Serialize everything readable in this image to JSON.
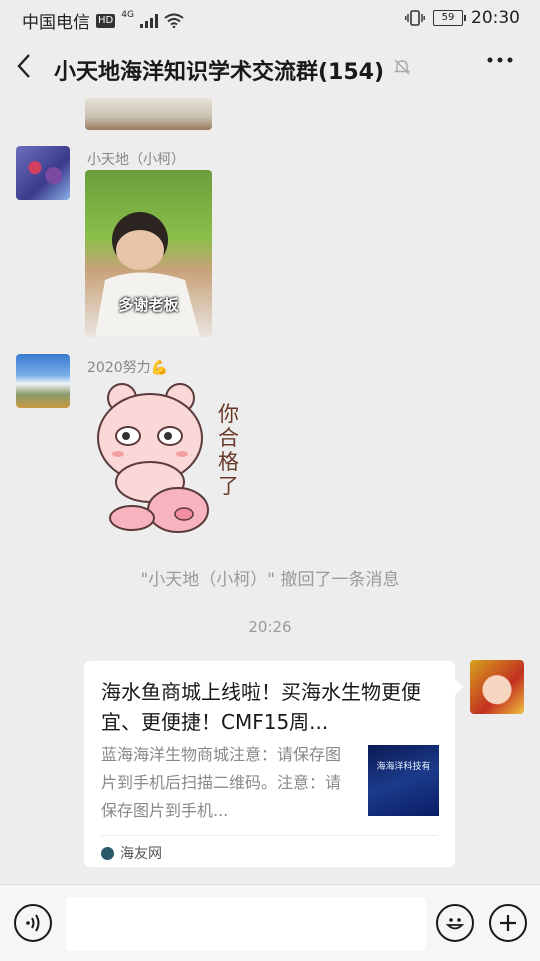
{
  "status": {
    "carrier": "中国电信",
    "hd": "HD",
    "network": "4G",
    "signal_icon": "signal-bars-icon",
    "wifi_icon": "wifi-icon",
    "vibrate_icon": "vibrate-icon",
    "battery": "59",
    "time": "20:30"
  },
  "header": {
    "back_icon": "back-chevron-icon",
    "title": "小天地海洋知识学术交流群(154)",
    "mute_icon": "bell-muted-icon",
    "more_icon": "more-dots-icon"
  },
  "messages": [
    {
      "type": "image",
      "caption": "多谢老板",
      "sender": "小天地（小柯）"
    },
    {
      "type": "sticker",
      "sender": "2020努力💪",
      "sticker_text": "你合格了"
    }
  ],
  "system_notice": "\"小天地（小柯）\" 撤回了一条消息",
  "timestamp": "20:26",
  "link_card": {
    "title": "海水鱼商城上线啦！买海水生物更便宜、更便捷！CMF15周...",
    "description": "蓝海海洋生物商城注意：请保存图片到手机后扫描二维码。注意：请保存图片到手机...",
    "thumb_text": "海海洋科技有",
    "source": "海友网"
  },
  "input_bar": {
    "voice_icon": "voice-icon",
    "emoji_icon": "emoji-icon",
    "plus_icon": "plus-icon"
  }
}
